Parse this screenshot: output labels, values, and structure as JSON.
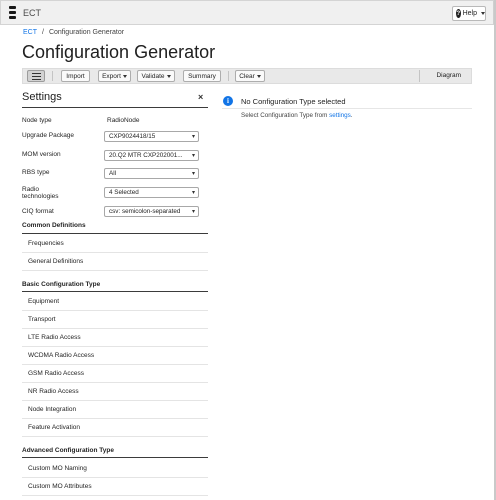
{
  "app": {
    "name": "ECT",
    "help_label": "Help"
  },
  "breadcrumb": {
    "root": "ECT",
    "separator": "/",
    "current": "Configuration Generator"
  },
  "page_title": "Configuration Generator",
  "toolbar": {
    "import": "Import",
    "export": "Export",
    "validate": "Validate",
    "summary": "Summary",
    "clear": "Clear",
    "diagram": "Diagram"
  },
  "settings": {
    "title": "Settings",
    "close_glyph": "×",
    "node_type": {
      "label": "Node type",
      "value": "RadioNode"
    },
    "upgrade_package": {
      "label": "Upgrade Package",
      "value": "CXP9024418/15"
    },
    "mom_version": {
      "label": "MOM version",
      "value": "20.Q2 MTR CXP202001..."
    },
    "rbs_type": {
      "label": "RBS type",
      "value": "All"
    },
    "radio_technologies": {
      "label_line1": "Radio",
      "label_line2": "technologies",
      "value": "4 Selected"
    },
    "ciq_format": {
      "label": "CIQ format",
      "value": "csv: semicolon-separated"
    }
  },
  "sections": {
    "common": {
      "title": "Common Definitions",
      "items": [
        "Frequencies",
        "General Definitions"
      ]
    },
    "basic": {
      "title": "Basic Configuration Type",
      "items": [
        "Equipment",
        "Transport",
        "LTE Radio Access",
        "WCDMA Radio Access",
        "GSM Radio Access",
        "NR Radio Access",
        "Node Integration",
        "Feature Activation"
      ]
    },
    "advanced": {
      "title": "Advanced Configuration Type",
      "items": [
        "Custom MO Naming",
        "Custom MO Attributes"
      ]
    }
  },
  "info_panel": {
    "icon_glyph": "i",
    "title": "No Configuration Type selected",
    "text_before": "Select Configuration Type from ",
    "link_text": "settings",
    "text_after": "."
  },
  "icons": {
    "logo": "ericsson-logo-icon",
    "help": "question-circle-icon",
    "list_view": "list-icon",
    "close": "close-icon",
    "info": "info-icon",
    "dropdown": "chevron-down-icon"
  },
  "colors": {
    "accent": "#1174e6",
    "topbar": "#f0f0f0",
    "toolbar": "#e9e9e9"
  }
}
